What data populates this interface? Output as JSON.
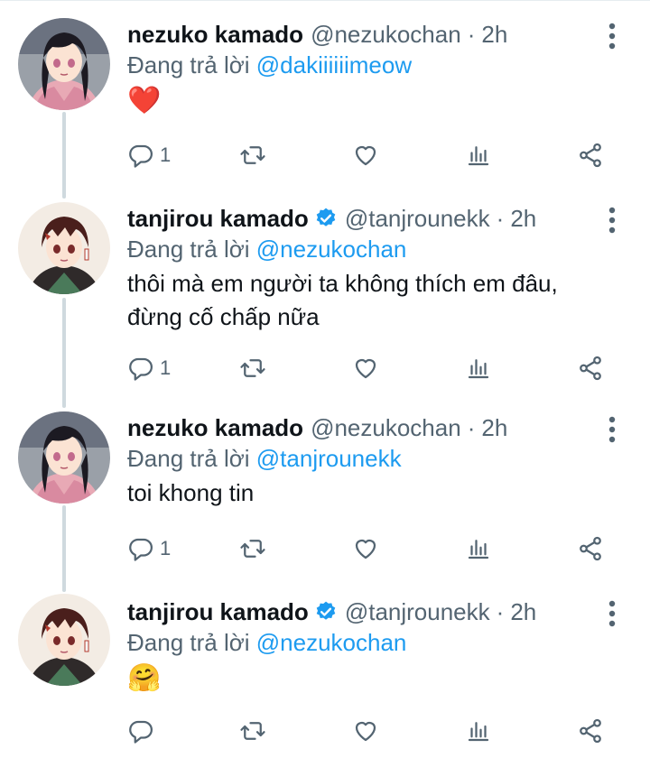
{
  "tweets": [
    {
      "display_name": "nezuko kamado",
      "handle": "@nezukochan",
      "time": "2h",
      "reply_prefix": "Đang trả lời ",
      "reply_to": "@dakiiiiiimeow",
      "content": "❤️",
      "reply_count": "1",
      "verified": false,
      "avatar": "nezuko-avatar"
    },
    {
      "display_name": "tanjirou kamado",
      "handle": "@tanjrounekk",
      "time": "2h",
      "reply_prefix": "Đang trả lời ",
      "reply_to": "@nezukochan",
      "content_line1": "thôi mà em người ta không thích em đâu,",
      "content_line2": "đừng cố chấp nữa",
      "reply_count": "1",
      "verified": true,
      "avatar": "tanjiro-avatar"
    },
    {
      "display_name": "nezuko kamado",
      "handle": "@nezukochan",
      "time": "2h",
      "reply_prefix": "Đang trả lời ",
      "reply_to": "@tanjrounekk",
      "content": "toi khong tin",
      "reply_count": "1",
      "verified": false,
      "avatar": "nezuko-avatar"
    },
    {
      "display_name": "tanjirou kamado",
      "handle": "@tanjrounekk",
      "time": "2h",
      "reply_prefix": "Đang trả lời ",
      "reply_to": "@nezukochan",
      "content": "🤗",
      "reply_count": "",
      "verified": true,
      "avatar": "tanjiro-avatar"
    }
  ],
  "separator": "·",
  "colors": {
    "accent": "#1d9bf0",
    "muted": "#536471",
    "text": "#0f1419",
    "thread_line": "#cfd9de"
  },
  "icons": [
    "reply-icon",
    "retweet-icon",
    "like-icon",
    "stats-icon",
    "share-icon",
    "more-icon",
    "verified-badge-icon"
  ]
}
